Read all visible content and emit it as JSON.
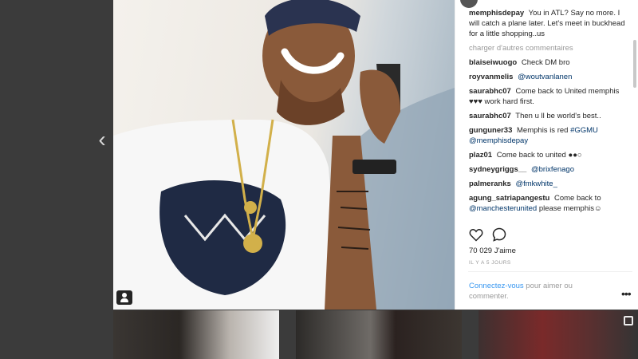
{
  "post": {
    "caption": {
      "user": "memphisdepay",
      "text": "You in ATL? Say no more. I will catch a plane later. Let's meet in buckhead for a little shopping..us"
    },
    "load_more_label": "charger d'autres commentaires",
    "comments": [
      {
        "user": "blaiseiwuogo",
        "text": "Check DM bro"
      },
      {
        "user": "royvanmelis",
        "mention": "@woutvanlanen",
        "text": ""
      },
      {
        "user": "saurabhc07",
        "text": "Come back to United memphis ♥♥♥ work hard first."
      },
      {
        "user": "saurabhc07",
        "text": "Then u ll be world's best.."
      },
      {
        "user": "gunguner33",
        "text": "Memphis is red ",
        "mention": "#GGMU",
        "mention2": "@memphisdepay"
      },
      {
        "user": "plaz01",
        "text": "Come back to united ●●○"
      },
      {
        "user": "sydneygriggs__",
        "mention": "@brixfenago",
        "text": ""
      },
      {
        "user": "palmeranks",
        "mention": "@fmkwhite_",
        "text": ""
      },
      {
        "user": "agung_satriapangestu",
        "text": "Come back to ",
        "mention": "@manchesterunited",
        "after": " please memphis☺"
      }
    ],
    "likes_label": "70 029 J'aime",
    "time_label": "IL Y A 5 JOURS",
    "login": {
      "link": "Connectez-vous",
      "text": " pour aimer ou commenter."
    },
    "more_label": "•••"
  },
  "icons": {
    "prev": "chevron-left-icon",
    "like": "heart-icon",
    "comment": "comment-icon",
    "user_tag": "user-tag-icon",
    "multi": "carousel-icon"
  },
  "colors": {
    "link": "#3897f0",
    "mention": "#003569",
    "muted": "#999999"
  }
}
